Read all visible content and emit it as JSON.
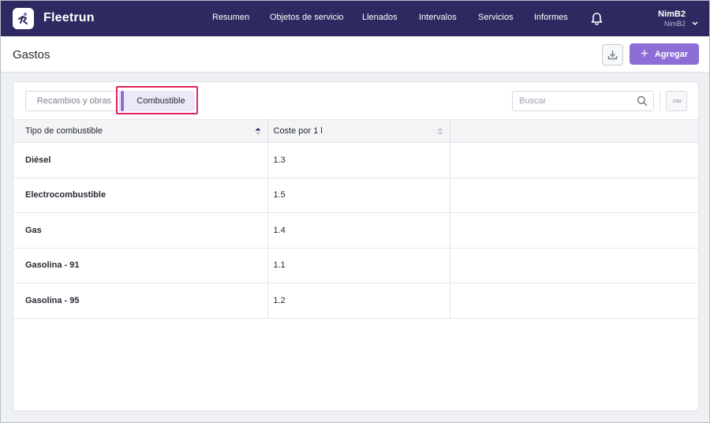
{
  "app": {
    "brand": "Fleetrun"
  },
  "nav": {
    "items": [
      "Resumen",
      "Objetos de servicio",
      "Llenados",
      "Intervalos",
      "Servicios",
      "Informes"
    ]
  },
  "user": {
    "name": "NimB2",
    "account": "NimB2"
  },
  "page": {
    "title": "Gastos",
    "add_label": "Agregar"
  },
  "tabs": [
    {
      "label": "Recambios y obras",
      "active": false
    },
    {
      "label": "Combustible",
      "active": true
    }
  ],
  "search": {
    "placeholder": "Buscar",
    "value": ""
  },
  "export": {
    "label": ".csv"
  },
  "table": {
    "columns": [
      "Tipo de combustible",
      "Coste por 1 l"
    ],
    "rows": [
      {
        "name": "Diésel",
        "cost": "1.3"
      },
      {
        "name": "Electrocombustible",
        "cost": "1.5"
      },
      {
        "name": "Gas",
        "cost": "1.4"
      },
      {
        "name": "Gasolina - 91",
        "cost": "1.1"
      },
      {
        "name": "Gasolina - 95",
        "cost": "1.2"
      }
    ]
  },
  "colors": {
    "nav_bg": "#2e2960",
    "accent": "#8c6ed6",
    "highlight_frame": "#e0245e",
    "active_tab_bg": "#ece8f9"
  },
  "icons": [
    "fleetrun-logo-icon",
    "bell-icon",
    "chevron-down-icon",
    "download-icon",
    "plus-icon",
    "search-icon",
    "sort-asc-icon",
    "sort-icon"
  ]
}
